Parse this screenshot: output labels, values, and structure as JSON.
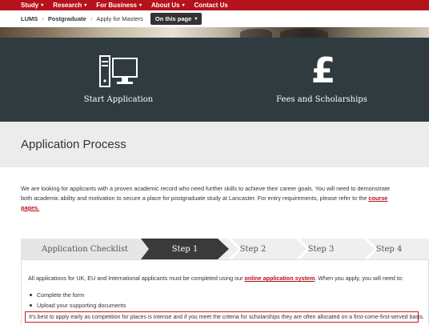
{
  "topnav": {
    "items": [
      {
        "label": "Study",
        "has_menu": true
      },
      {
        "label": "Research",
        "has_menu": true
      },
      {
        "label": "For Business",
        "has_menu": true
      },
      {
        "label": "About Us",
        "has_menu": true
      },
      {
        "label": "Contact Us",
        "has_menu": false
      }
    ],
    "caret": "▾"
  },
  "breadcrumb": {
    "items": [
      "LUMS",
      "Postgraduate",
      "Apply for Masters"
    ],
    "separator": "›",
    "on_this_page": "On this page",
    "caret": "▾"
  },
  "tiles": {
    "start": {
      "label": "Start Application",
      "icon": "computer-icon"
    },
    "fees": {
      "label": "Fees and Scholarships",
      "icon": "pound-icon",
      "glyph": "£"
    }
  },
  "page_title": "Application Process",
  "intro": {
    "text_before": "We are looking for applicants with a proven academic record who need further skills to achieve their career goals. You will need to demonstrate both academic ability and motivation to secure a place for postgraduate study at Lancaster. For entry requirements, please refer to the ",
    "link": "course pages.",
    "text_after": ""
  },
  "stepper": {
    "checklist": "Application Checklist",
    "steps": [
      "Step 1",
      "Step 2",
      "Step 3",
      "Step 4"
    ],
    "active_step": 1
  },
  "content": {
    "para_before": "All applications for UK, EU and International applicants must be completed using our ",
    "para_link": "online application system",
    "para_after": ". When you apply, you will need to:",
    "list": [
      "Complete the form",
      "Upload your supporting documents"
    ],
    "highlight": "It's best to apply early as competition for places is intense and if you meet the criteria for scholarships they are often allocated on a first-come-first-served basis."
  },
  "colors": {
    "brand_red": "#b5121b",
    "dark_panel": "#2f3b3f",
    "active_step": "#3a3a3a",
    "highlight_border": "#d4151c"
  }
}
